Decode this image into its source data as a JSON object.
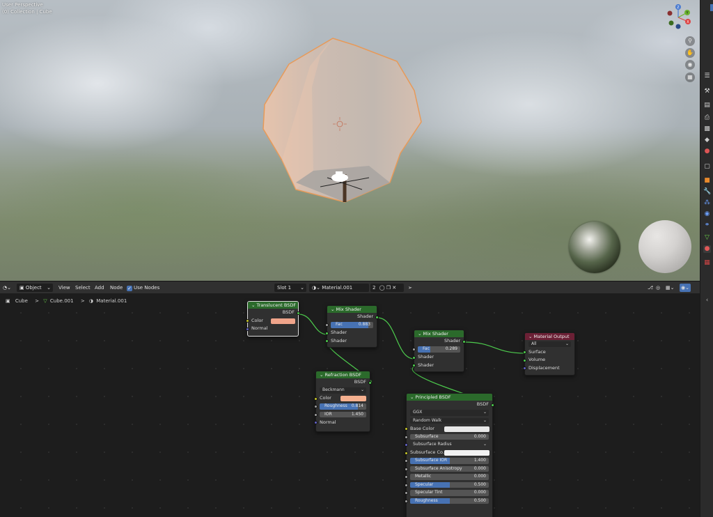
{
  "viewport": {
    "mode_label": "User Perspective",
    "collection_label": "(0) Collection | Cube",
    "gizmo": {
      "z": "Z",
      "y": "Y",
      "x": "X"
    }
  },
  "editor_header": {
    "editor_type": "node-editor",
    "object_mode": "Object",
    "menus": [
      "View",
      "Select",
      "Add",
      "Node"
    ],
    "use_nodes_label": "Use Nodes",
    "use_nodes": true,
    "slot": "Slot 1",
    "material_name": "Material.001",
    "user_count": "2"
  },
  "breadcrumb": {
    "object": "Cube",
    "mesh": "Cube.001",
    "material": "Material.001",
    "sep": ">"
  },
  "nodes": {
    "translucent": {
      "title": "Translucent BSDF",
      "out": "BSDF",
      "color_label": "Color",
      "normal_label": "Normal",
      "color": "#f0a48a"
    },
    "mix1": {
      "title": "Mix Shader",
      "out": "Shader",
      "fac_label": "Fac",
      "fac_value": "0.883",
      "fac": 0.883,
      "shader1": "Shader",
      "shader2": "Shader"
    },
    "mix2": {
      "title": "Mix Shader",
      "out": "Shader",
      "fac_label": "Fac",
      "fac_value": "0.289",
      "fac": 0.289,
      "shader1": "Shader",
      "shader2": "Shader"
    },
    "output": {
      "title": "Material Output",
      "target": "All",
      "surface": "Surface",
      "volume": "Volume",
      "displacement": "Displacement"
    },
    "refraction": {
      "title": "Refraction BSDF",
      "out": "BSDF",
      "distribution": "Beckmann",
      "color_label": "Color",
      "color": "#f5b08f",
      "roughness_label": "Roughness",
      "roughness_value": "0.814",
      "roughness": 0.814,
      "ior_label": "IOR",
      "ior_value": "1.450",
      "normal_label": "Normal"
    },
    "principled": {
      "title": "Principled BSDF",
      "out": "BSDF",
      "distribution": "GGX",
      "sss_method": "Random Walk",
      "base_color_label": "Base Color",
      "base_color": "#e8e8e8",
      "subsurface_label": "Subsurface",
      "subsurface_value": "0.000",
      "subsurface_radius_label": "Subsurface Radius",
      "subsurface_color_label": "Subsurface Co...",
      "subsurface_color": "#f2f2f2",
      "subsurface_ior_label": "Subsurface IOR",
      "subsurface_ior_value": "1.400",
      "subsurface_aniso_label": "Subsurface Anisotropy",
      "subsurface_aniso_value": "0.000",
      "metallic_label": "Metallic",
      "metallic_value": "0.000",
      "specular_label": "Specular",
      "specular_value": "0.500",
      "specular": 0.5,
      "specular_tint_label": "Specular Tint",
      "specular_tint_value": "0.000",
      "roughness_label": "Roughness",
      "roughness_value": "0.500",
      "roughness": 0.5
    }
  }
}
